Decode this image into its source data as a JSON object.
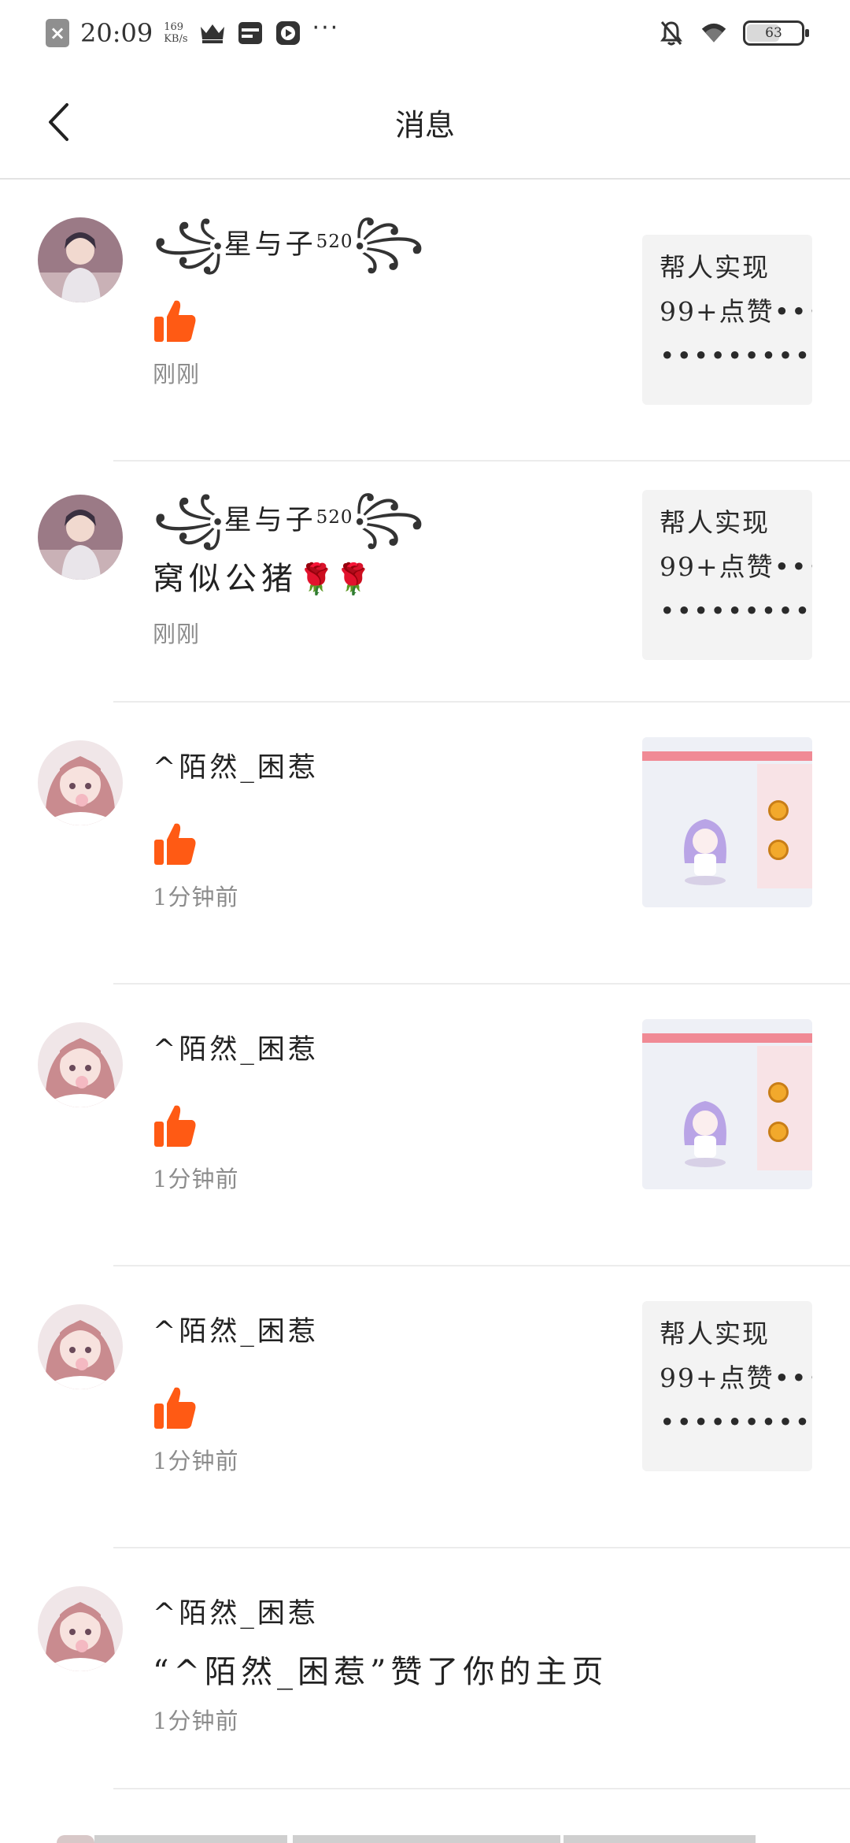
{
  "status_bar": {
    "time": "20:09",
    "net_speed_value": "169",
    "net_speed_unit": "KB/s",
    "more_indicator": "···",
    "battery_level": "63",
    "battery_percent": 63
  },
  "header": {
    "title": "消息"
  },
  "messages": [
    {
      "user": "星与子",
      "user_suffix": "520",
      "type": "like",
      "time": "刚刚",
      "preview_text_lines": [
        "帮人实现",
        "99+点赞•••",
        "••••••••••••"
      ]
    },
    {
      "user": "星与子",
      "user_suffix": "520",
      "type": "comment",
      "comment": "窝似公猪",
      "comment_emoji": "🌹🌹",
      "time": "刚刚",
      "preview_text_lines": [
        "帮人实现",
        "99+点赞•••",
        "••••••••••••"
      ]
    },
    {
      "user": "^陌然_困惹",
      "type": "like",
      "time": "1分钟前",
      "preview": "screenshot"
    },
    {
      "user": "^陌然_困惹",
      "type": "like",
      "time": "1分钟前",
      "preview": "screenshot"
    },
    {
      "user": "^陌然_困惹",
      "type": "like",
      "time": "1分钟前",
      "preview_text_lines": [
        "帮人实现",
        "99+点赞•••",
        "••••••••••••"
      ]
    },
    {
      "user": "^陌然_困惹",
      "type": "profile_like",
      "comment": "“^陌然_困惹”赞了你的主页",
      "time": "1分钟前"
    }
  ],
  "colors": {
    "like_orange": "#ff5a14",
    "divider": "#ececec",
    "time_gray": "#8c8c8c",
    "preview_bg": "#f3f3f3"
  },
  "icons": [
    "back-arrow-icon",
    "thumbs-up-icon",
    "crown-icon",
    "card-icon",
    "play-icon",
    "mute-icon",
    "wifi-icon",
    "battery-icon"
  ]
}
